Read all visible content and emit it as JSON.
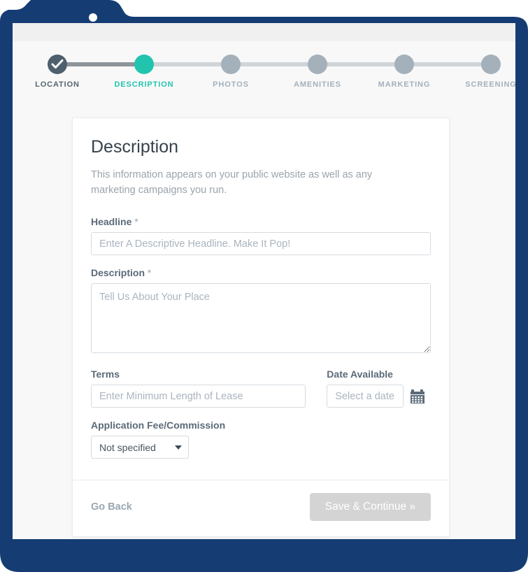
{
  "browser": {
    "frame_color": "#153d73",
    "tab_dot": "tab-indicator-dot"
  },
  "stepper": {
    "steps": [
      {
        "label": "LOCATION",
        "state": "done"
      },
      {
        "label": "DESCRIPTION",
        "state": "active"
      },
      {
        "label": "PHOTOS",
        "state": "upcoming"
      },
      {
        "label": "AMENITIES",
        "state": "upcoming"
      },
      {
        "label": "MARKETING",
        "state": "upcoming"
      },
      {
        "label": "SCREENING",
        "state": "upcoming"
      }
    ],
    "colors": {
      "done": "#4e5f6e",
      "active": "#22c4ae",
      "upcoming": "#a4b0ba",
      "connector": "#cfd4d8",
      "connector_filled": "#8d949a"
    }
  },
  "card": {
    "title": "Description",
    "subtitle": "This information appears on your public website as well as any marketing campaigns you run.",
    "fields": {
      "headline": {
        "label": "Headline",
        "required_mark": "*",
        "placeholder": "Enter A Descriptive Headline. Make It Pop!",
        "value": ""
      },
      "description": {
        "label": "Description",
        "required_mark": "*",
        "placeholder": "Tell Us About Your Place",
        "value": ""
      },
      "terms": {
        "label": "Terms",
        "placeholder": "Enter Minimum Length of Lease",
        "value": ""
      },
      "date_available": {
        "label": "Date Available",
        "placeholder": "Select a date",
        "value": "",
        "icon": "calendar-icon"
      },
      "application_fee": {
        "label": "Application Fee/Commission",
        "selected": "Not specified",
        "options": [
          "Not specified"
        ]
      }
    },
    "footer": {
      "go_back": "Go Back",
      "save_continue": "Save & Continue »"
    }
  }
}
